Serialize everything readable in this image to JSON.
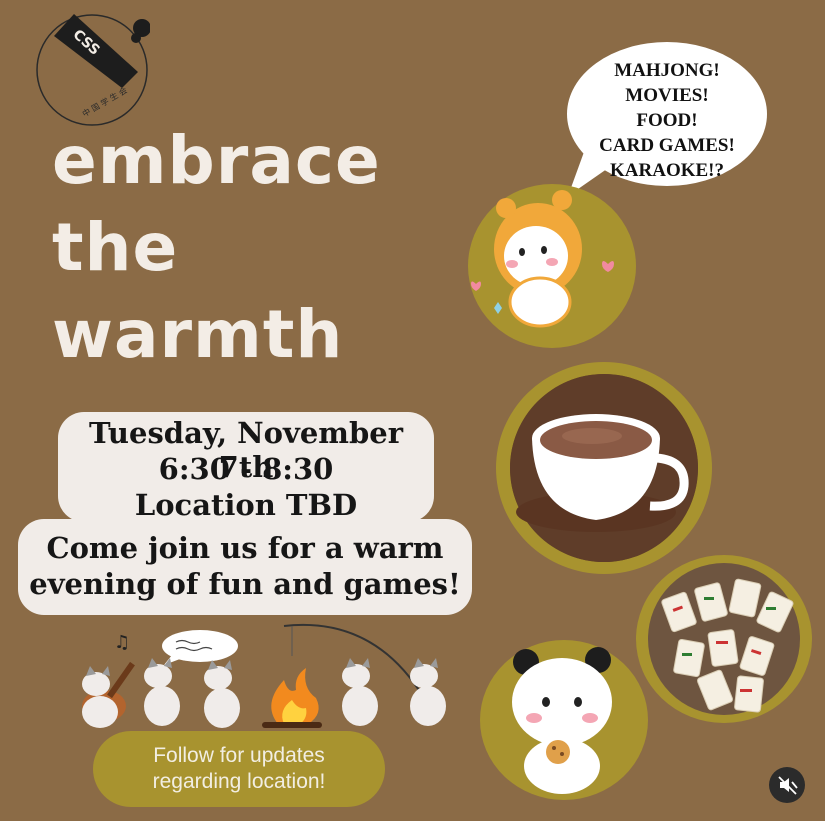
{
  "logo": {
    "text": "CSS",
    "subtext": "中 国 学 生 会"
  },
  "headline": {
    "line1": "embrace",
    "line2": "the",
    "line3": "warmth"
  },
  "bubble": {
    "lines": [
      "MAHJONG!",
      "MOVIES!",
      "FOOD!",
      "CARD GAMES!",
      "KARAOKE!?"
    ]
  },
  "event": {
    "date": "Tuesday, November 7th",
    "time": "6:30 - 8:30",
    "location": "Location TBD",
    "invite_line1": "Come join us for a warm",
    "invite_line2": "evening of fun and games!"
  },
  "cta": {
    "line1": "Follow for updates",
    "line2": "regarding location!"
  },
  "icons": {
    "mute": "speaker-muted-icon"
  },
  "colors": {
    "background": "#8b6b46",
    "olive": "#a8932f",
    "cream": "#f1ece8"
  }
}
